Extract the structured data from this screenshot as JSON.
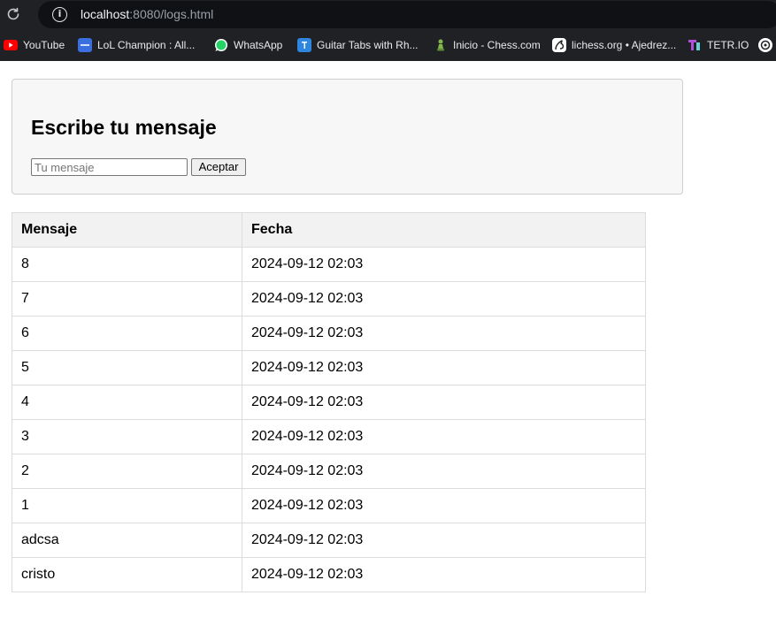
{
  "browser": {
    "url_host": "localhost",
    "url_rest": ":8080/logs.html",
    "bookmarks": [
      {
        "label": "YouTube",
        "icon": "youtube-icon"
      },
      {
        "label": "LoL Champion : All...",
        "icon": "lol-icon"
      },
      {
        "label": "WhatsApp",
        "icon": "whatsapp-icon"
      },
      {
        "label": "Guitar Tabs with Rh...",
        "icon": "guitar-tabs-icon"
      },
      {
        "label": "Inicio - Chess.com",
        "icon": "chess-pawn-icon"
      },
      {
        "label": "lichess.org • Ajedrez...",
        "icon": "lichess-icon"
      },
      {
        "label": "TETR.IO",
        "icon": "tetrio-icon"
      },
      {
        "label": "",
        "icon": "openai-icon"
      }
    ]
  },
  "form": {
    "title": "Escribe tu mensaje",
    "input_placeholder": "Tu mensaje",
    "input_value": "",
    "button_label": "Aceptar"
  },
  "table": {
    "headers": [
      "Mensaje",
      "Fecha"
    ],
    "rows": [
      [
        "8",
        "2024-09-12 02:03"
      ],
      [
        "7",
        "2024-09-12 02:03"
      ],
      [
        "6",
        "2024-09-12 02:03"
      ],
      [
        "5",
        "2024-09-12 02:03"
      ],
      [
        "4",
        "2024-09-12 02:03"
      ],
      [
        "3",
        "2024-09-12 02:03"
      ],
      [
        "2",
        "2024-09-12 02:03"
      ],
      [
        "1",
        "2024-09-12 02:03"
      ],
      [
        "adcsa",
        "2024-09-12 02:03"
      ],
      [
        "cristo",
        "2024-09-12 02:03"
      ]
    ]
  },
  "colors": {
    "chrome_bg": "#202124",
    "card_bg": "#f7f7f7",
    "header_bg": "#f2f2f2"
  }
}
